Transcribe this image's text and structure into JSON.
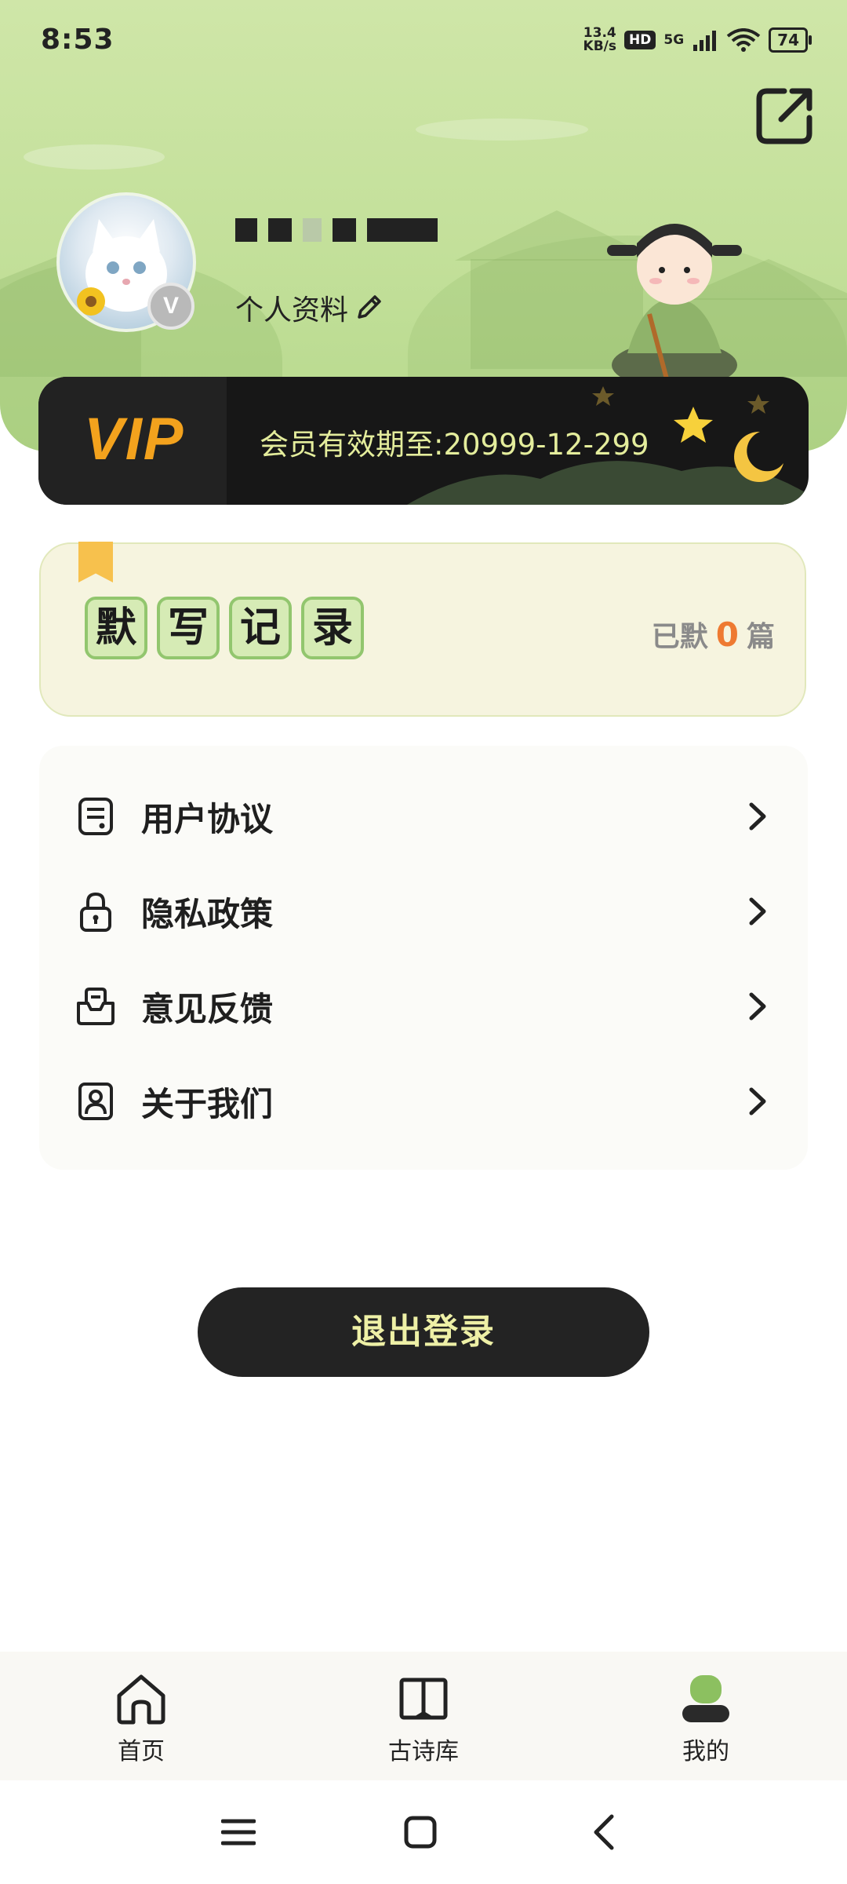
{
  "status_bar": {
    "time": "8:53",
    "speed_value": "13.4",
    "speed_unit": "KB/s",
    "hd": "HD",
    "network": "5G",
    "battery": "74"
  },
  "profile": {
    "avatar_badge": "V",
    "profile_link": "个人资料"
  },
  "vip": {
    "logo": "VIP",
    "expiry": "会员有效期至:20999-12-299"
  },
  "dictation": {
    "title_chars": [
      "默",
      "写",
      "记",
      "录"
    ],
    "count_prefix": "已默",
    "count_value": "0",
    "count_suffix": "篇"
  },
  "menu": {
    "items": [
      {
        "label": "用户协议",
        "icon": "document-icon"
      },
      {
        "label": "隐私政策",
        "icon": "lock-icon"
      },
      {
        "label": "意见反馈",
        "icon": "feedback-icon"
      },
      {
        "label": "关于我们",
        "icon": "contact-card-icon"
      }
    ]
  },
  "logout": {
    "label": "退出登录"
  },
  "bottom_nav": {
    "items": [
      {
        "label": "首页",
        "icon": "home-icon"
      },
      {
        "label": "古诗库",
        "icon": "book-icon"
      },
      {
        "label": "我的",
        "icon": "user-icon",
        "active": true
      }
    ]
  },
  "colors": {
    "header_green": "#c3e09a",
    "vip_gold": "#f3a21d",
    "vip_text": "#e4ed9c",
    "count_orange": "#ee7a32",
    "logout_bg": "#232323",
    "active_nav_green": "#8cc060"
  }
}
